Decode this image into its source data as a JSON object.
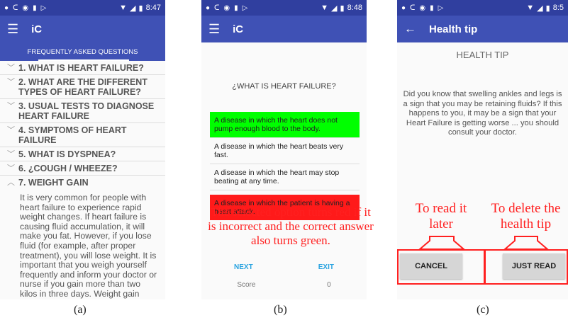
{
  "panel_a": {
    "status_time": "8:47",
    "app_title": "iC",
    "tab_label": "FREQUENTLY ASKED QUESTIONS",
    "faq": [
      {
        "label": "1. WHAT IS HEART FAILURE?",
        "expanded": false
      },
      {
        "label": "2. WHAT ARE THE DIFFERENT TYPES OF HEART FAILURE?",
        "expanded": false
      },
      {
        "label": "3. USUAL TESTS TO DIAGNOSE HEART FAILURE",
        "expanded": false
      },
      {
        "label": "4. SYMPTOMS OF HEART FAILURE",
        "expanded": false
      },
      {
        "label": "5. WHAT IS DYSPNEA?",
        "expanded": false
      },
      {
        "label": "6. ¿COUGH / WHEEZE?",
        "expanded": false
      },
      {
        "label": "7. WEIGHT GAIN",
        "expanded": true
      }
    ],
    "expanded_text": "It is very common for people with heart failure to experience rapid weight changes. If heart failure is causing fluid accumulation, it will make you fat. However, if you lose fluid (for example, after proper treatment), you will lose weight. It is important that you weigh yourself frequently and inform your doctor or nurse if you gain more than two kilos in three days. Weight gain",
    "caption": "(a)"
  },
  "panel_b": {
    "status_time": "8:48",
    "app_title": "iC",
    "question": "¿WHAT IS HEART FAILURE?",
    "answers": [
      {
        "text": "A disease in which the heart does not pump enough blood to the body.",
        "state": "correct",
        "color": "#00ff00"
      },
      {
        "text": "A disease in which the heart beats very fast.",
        "state": "neutral"
      },
      {
        "text": "A disease in which the heart may stop beating at any time.",
        "state": "neutral"
      },
      {
        "text": "A disease in which the patient is having a heart attack.",
        "state": "incorrect",
        "color": "#ff1a1a"
      }
    ],
    "next_label": "NEXT",
    "exit_label": "EXIT",
    "score_label": "Score",
    "score_value": "0",
    "annotation": "The selected option turns red if it is incorrect and the correct answer also turns green.",
    "caption": "(b)"
  },
  "panel_c": {
    "status_time": "8:5",
    "app_title": "Health tip",
    "heading": "HEALTH TIP",
    "tip_text": "Did you know that swelling ankles and legs is a sign that you may be retaining fluids? If this happens to you, it may be a sign that your Heart Failure is getting worse ... you should consult your doctor.",
    "cancel_label": "CANCEL",
    "read_label": "JUST READ",
    "annotation_left": "To read it later",
    "annotation_right": "To delete the health tip",
    "caption": "(c)"
  },
  "colors": {
    "statusbar": "#303f9f",
    "appbar": "#3f51b5",
    "link": "#29a3e0",
    "annotation": "#ff2020"
  }
}
